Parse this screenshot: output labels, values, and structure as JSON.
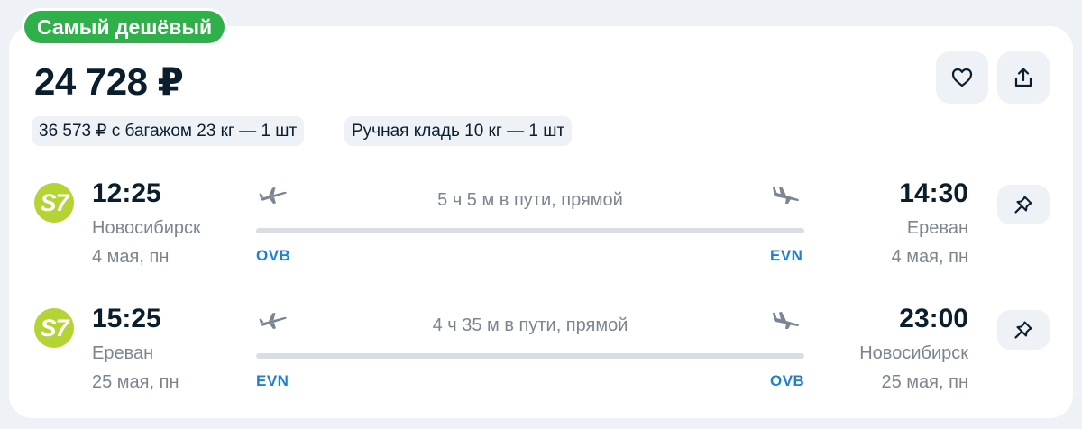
{
  "offer": {
    "badge": "Самый дешёвый",
    "price": "24 728 ₽",
    "actions": {
      "favorite_icon": "heart-icon",
      "share_icon": "share-icon"
    },
    "chips": {
      "baggage": "36 573 ₽ с багажом 23 кг — 1 шт",
      "hand_luggage": "Ручная кладь 10 кг — 1 шт"
    }
  },
  "colors": {
    "badge_bg": "#2fb04a",
    "airline_logo": "#b4d334",
    "airport_code": "#1f7fd8",
    "muted_text": "#7a8591"
  },
  "segments": [
    {
      "airline_logo": "S7",
      "dep_time": "12:25",
      "dep_city": "Новосибирск",
      "dep_date": "4 мая, пн",
      "duration": "5 ч 5 м в пути, прямой",
      "dep_code": "OVB",
      "arr_code": "EVN",
      "arr_time": "14:30",
      "arr_city": "Ереван",
      "arr_date": "4 мая, пн"
    },
    {
      "airline_logo": "S7",
      "dep_time": "15:25",
      "dep_city": "Ереван",
      "dep_date": "25 мая, пн",
      "duration": "4 ч 35 м в пути, прямой",
      "dep_code": "EVN",
      "arr_code": "OVB",
      "arr_time": "23:00",
      "arr_city": "Новосибирск",
      "arr_date": "25 мая, пн"
    }
  ]
}
